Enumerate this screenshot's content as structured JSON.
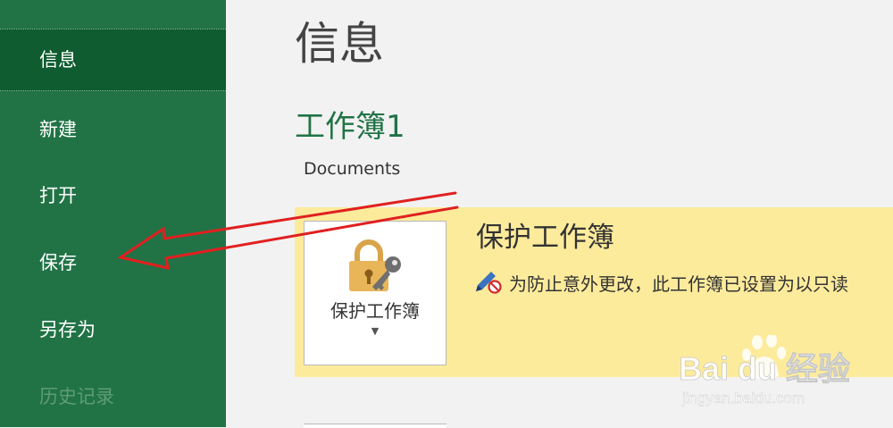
{
  "sidebar": {
    "items": [
      {
        "label": "信息",
        "state": "active"
      },
      {
        "label": "新建",
        "state": "normal"
      },
      {
        "label": "打开",
        "state": "normal"
      },
      {
        "label": "保存",
        "state": "normal"
      },
      {
        "label": "另存为",
        "state": "normal"
      },
      {
        "label": "历史记录",
        "state": "disabled"
      }
    ]
  },
  "main": {
    "title": "信息",
    "document_name": "工作簿1",
    "document_location": "Documents",
    "protect": {
      "button_label": "保护工作簿",
      "heading": "保护工作簿",
      "description": "为防止意外更改，此工作簿已设置为以只读"
    }
  },
  "icons": {
    "protect_button": "lock-key-icon",
    "dropdown": "chevron-down-icon",
    "description": "edit-restricted-icon"
  },
  "colors": {
    "sidebar_bg": "#217346",
    "sidebar_active": "#0e5c2f",
    "accent_text": "#217346",
    "protect_panel": "#fdeb9c",
    "annotation_arrow": "#e02020"
  },
  "watermark": {
    "brand": "Bai du 经验",
    "url": "jingyan.baidu.com"
  }
}
